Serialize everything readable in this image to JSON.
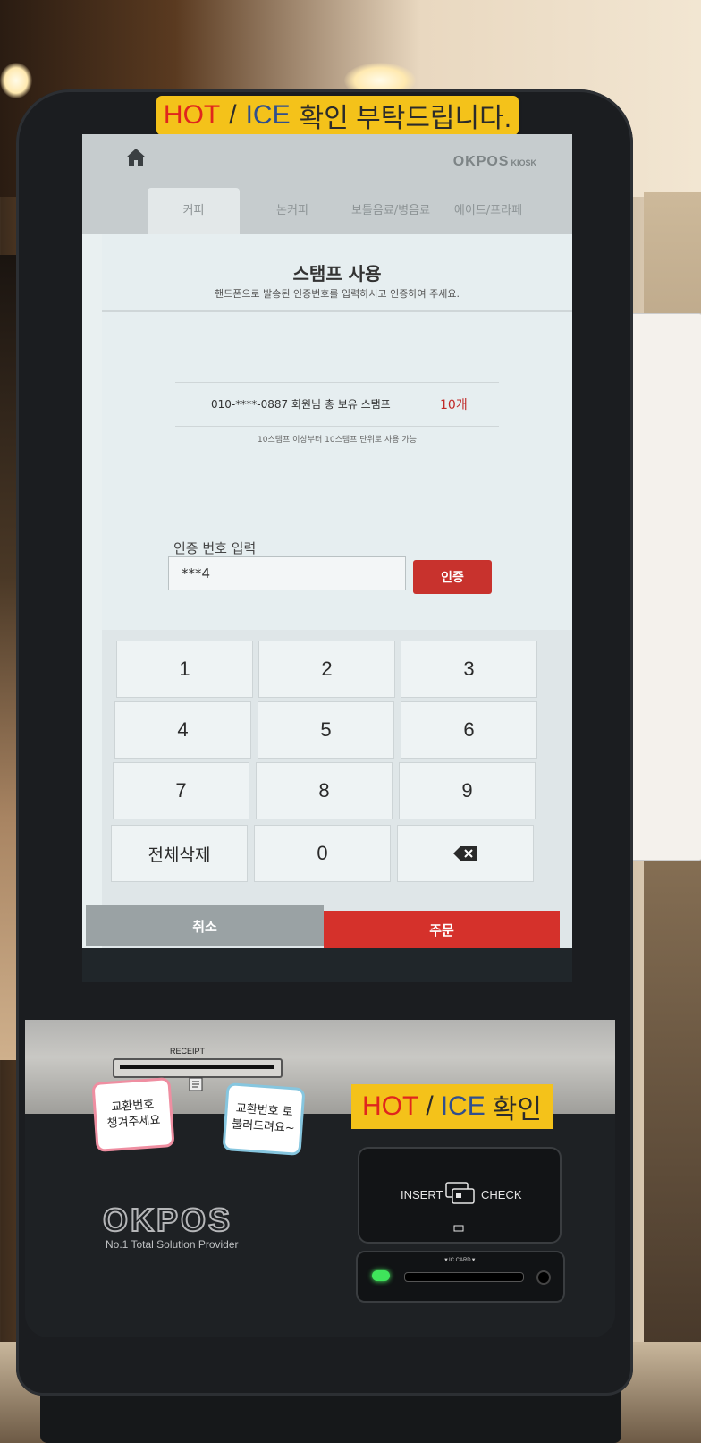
{
  "top_sign": {
    "hot": "HOT",
    "slash": "/",
    "ice": "ICE",
    "text": "확인 부탁드립니다."
  },
  "header": {
    "brand": "OKPOS",
    "brand_sub": "KIOSK"
  },
  "tabs": [
    {
      "label": "커피",
      "active": true
    },
    {
      "label": "논커피",
      "active": false
    },
    {
      "label": "보틀음료/병음료",
      "active": false
    },
    {
      "label": "에이드/프라페",
      "active": false
    }
  ],
  "dialog": {
    "title": "스탬프 사용",
    "subtitle": "핸드폰으로 발송된 인증번호를 입력하시고 인증하여 주세요.",
    "stamp_label": "010-****-0887 회원님 총 보유 스탬프",
    "stamp_count": "10개",
    "stamp_note": "10스탬프 이상부터 10스탬프 단위로 사용 가능",
    "code_label": "인증 번호 입력",
    "code_value": "***4",
    "auth_button": "인증"
  },
  "keypad": {
    "keys": [
      "1",
      "2",
      "3",
      "4",
      "5",
      "6",
      "7",
      "8",
      "9"
    ],
    "clear_all": "전체삭제",
    "zero": "0",
    "backspace_icon": "backspace-icon"
  },
  "actions": {
    "cancel": "취소",
    "order": "주문"
  },
  "hardware": {
    "receipt_label": "RECEIPT",
    "note_pink": [
      "교환번호",
      "챙겨주세요"
    ],
    "note_blue": [
      "교환번호 로",
      "불러드려요~"
    ],
    "bottom_sign": {
      "hot": "HOT",
      "slash": "/",
      "ice": "ICE",
      "text": "확인"
    },
    "logo": "OKPOS",
    "tagline": "No.1 Total Solution Provider",
    "reader_insert": "INSERT",
    "reader_check": "CHECK",
    "ic_card": "▼IC CARD▼"
  },
  "colors": {
    "accent_red": "#d5312b",
    "sign_yellow": "#f4c21a",
    "hot_red": "#e0261d",
    "ice_blue": "#304f8e",
    "led_green": "#3fe45b"
  }
}
